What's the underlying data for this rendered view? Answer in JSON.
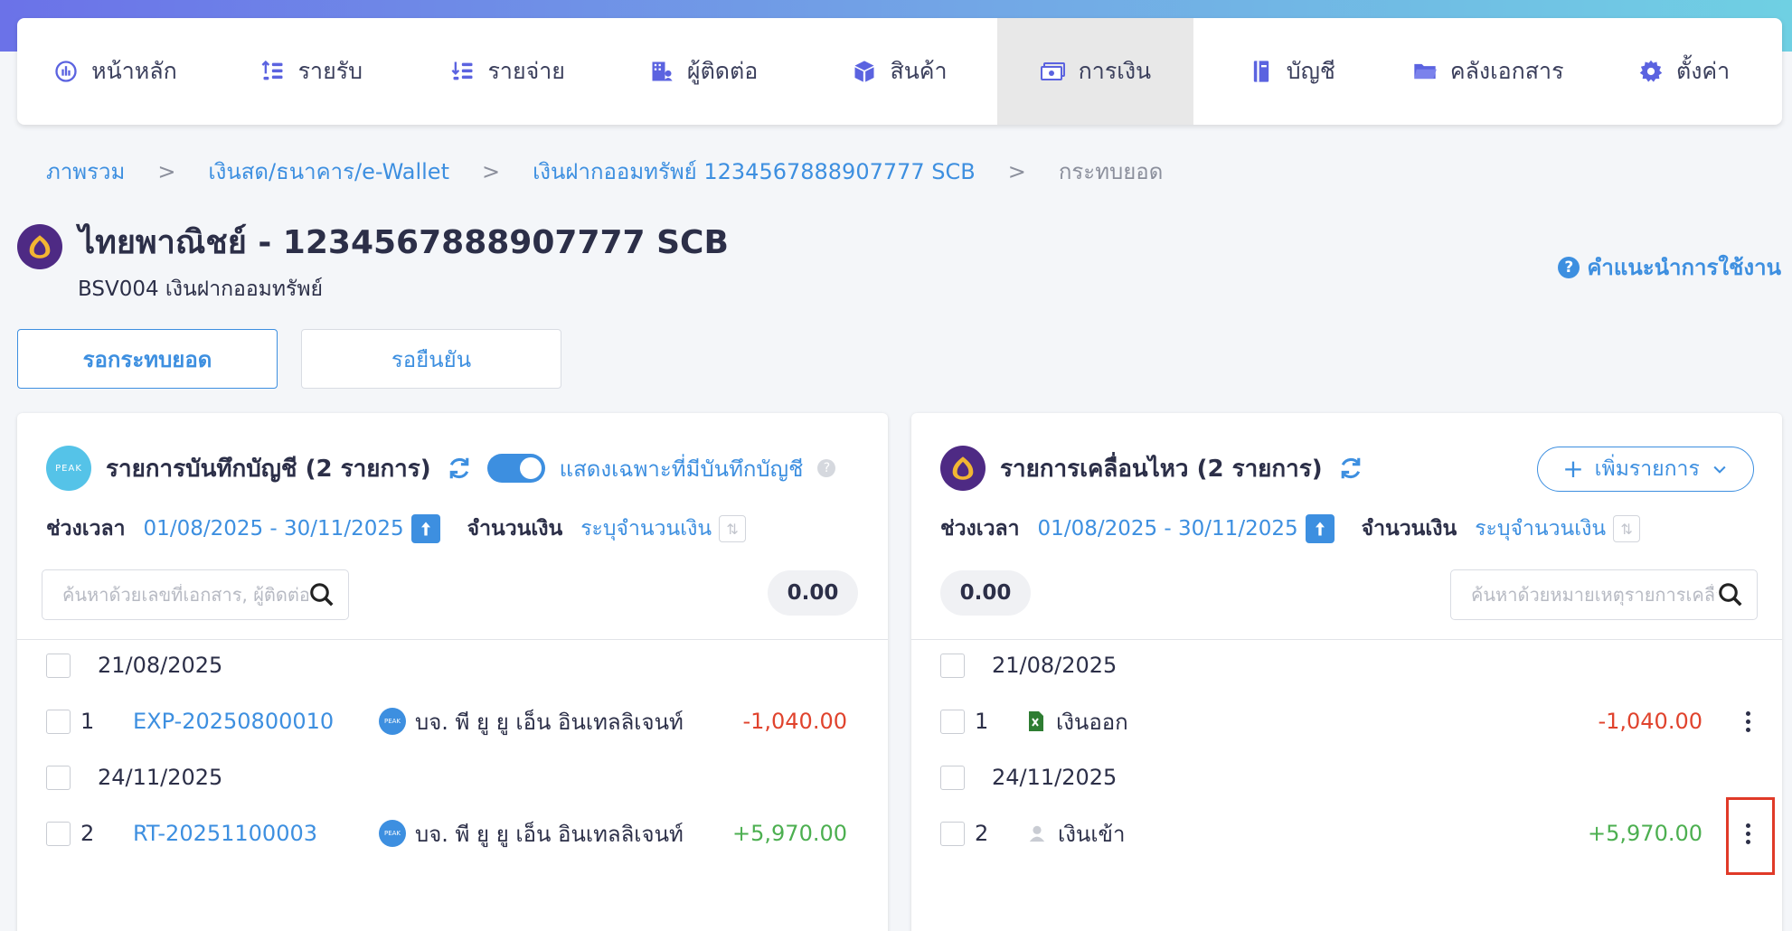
{
  "nav": {
    "items": [
      {
        "label": "หน้าหลัก",
        "icon": "dashboard-icon"
      },
      {
        "label": "รายรับ",
        "icon": "income-icon"
      },
      {
        "label": "รายจ่าย",
        "icon": "expense-icon"
      },
      {
        "label": "ผู้ติดต่อ",
        "icon": "contacts-icon"
      },
      {
        "label": "สินค้า",
        "icon": "product-box-icon"
      },
      {
        "label": "การเงิน",
        "icon": "money-icon"
      },
      {
        "label": "บัญชี",
        "icon": "ledger-icon"
      },
      {
        "label": "คลังเอกสาร",
        "icon": "folder-icon"
      },
      {
        "label": "ตั้งค่า",
        "icon": "gear-icon"
      }
    ],
    "active_index": 5
  },
  "breadcrumb": {
    "items": [
      "ภาพรวม",
      "เงินสด/ธนาคาร/e-Wallet",
      "เงินฝากออมทรัพย์ 1234567888907777 SCB"
    ],
    "separator": ">",
    "current": "กระทบยอด"
  },
  "header": {
    "title": "ไทยพาณิชย์ - 1234567888907777 SCB",
    "subtitle": "BSV004 เงินฝากออมทรัพย์",
    "help": "คำแนะนำการใช้งาน"
  },
  "tabs": {
    "pending_reconcile": "รอกระทบยอด",
    "pending_confirm": "รอยืนยัน"
  },
  "left_panel": {
    "logo_text": "PEAK",
    "title": "รายการบันทึกบัญชี (2 รายการ)",
    "toggle_label": "แสดงเฉพาะที่มีบันทึกบัญชี",
    "period_label": "ช่วงเวลา",
    "period_value": "01/08/2025 - 30/11/2025",
    "amount_label": "จำนวนเงิน",
    "amount_value": "ระบุจำนวนเงิน",
    "search_placeholder": "ค้นหาด้วยเลขที่เอกสาร, ผู้ติดต่อ",
    "total": "0.00",
    "groups": [
      {
        "date": "21/08/2025",
        "rows": [
          {
            "index": "1",
            "doc": "EXP-20250800010",
            "contact": "บจ. พี ยู ยู เอ็น อินเทลลิเจนท์",
            "amount": "-1,040.00"
          }
        ]
      },
      {
        "date": "24/11/2025",
        "rows": [
          {
            "index": "2",
            "doc": "RT-20251100003",
            "contact": "บจ. พี ยู ยู เอ็น อินเทลลิเจนท์",
            "amount": "+5,970.00"
          }
        ]
      }
    ]
  },
  "right_panel": {
    "title": "รายการเคลื่อนไหว (2 รายการ)",
    "add_button": "เพิ่มรายการ",
    "period_label": "ช่วงเวลา",
    "period_value": "01/08/2025 - 30/11/2025",
    "amount_label": "จำนวนเงิน",
    "amount_value": "ระบุจำนวนเงิน",
    "search_placeholder": "ค้นหาด้วยหมายเหตุรายการเคลื่อนไหว",
    "total": "0.00",
    "groups": [
      {
        "date": "21/08/2025",
        "rows": [
          {
            "index": "1",
            "desc": "เงินออก",
            "icon": "excel-file-icon",
            "amount": "-1,040.00"
          }
        ]
      },
      {
        "date": "24/11/2025",
        "rows": [
          {
            "index": "2",
            "desc": "เงินเข้า",
            "icon": "user-icon",
            "amount": "+5,970.00"
          }
        ]
      }
    ]
  },
  "colors": {
    "accent": "#3d8fe0",
    "negative": "#e0432d",
    "positive": "#4caf50",
    "scb_purple": "#4e2a84",
    "peak_blue": "#55c3e8",
    "highlight": "#e03a28"
  }
}
